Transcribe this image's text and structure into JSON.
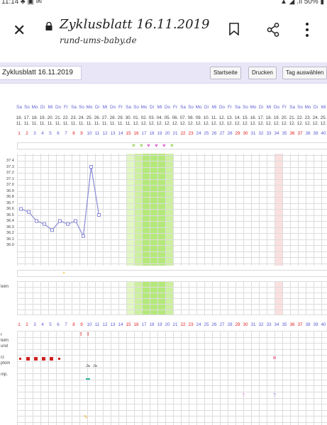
{
  "status_bar": {
    "left": "11:14 ♣ ▣ ✉",
    "right": "▲ ◢ .ıl 50% ▮"
  },
  "browser": {
    "title": "Zyklusblatt 16.11.2019",
    "url": "rund-ums-baby.de",
    "icons": [
      "close-icon",
      "lock-icon",
      "bookmark-icon",
      "share-icon",
      "more-vert-icon"
    ]
  },
  "toolbar": {
    "input_value": "Zyklusblatt 16.11.2019",
    "buttons": [
      "Startseite",
      "Drucken",
      "Tag auswählen"
    ]
  },
  "days": {
    "weekdays": [
      "Sa",
      "So",
      "Mo",
      "Di",
      "Mi",
      "Do",
      "Fr",
      "Sa",
      "So",
      "Mo",
      "Di",
      "Mi",
      "Do",
      "Fr",
      "Sa",
      "So",
      "Mo",
      "Di",
      "Mi",
      "Do",
      "Fr",
      "Sa",
      "So",
      "Mo",
      "Di",
      "Mi",
      "Do",
      "Fr",
      "Sa",
      "So",
      "Mo",
      "Di",
      "Mi",
      "Do",
      "Fr",
      "Sa",
      "So",
      "Mo",
      "Di",
      "Mi"
    ],
    "dates": [
      "16.",
      "17.",
      "18.",
      "19.",
      "20.",
      "21.",
      "22.",
      "23.",
      "24.",
      "25.",
      "26.",
      "27.",
      "28.",
      "29.",
      "30.",
      "01.",
      "02.",
      "03.",
      "04.",
      "05.",
      "06.",
      "07.",
      "08.",
      "09.",
      "10.",
      "11.",
      "12.",
      "13.",
      "14.",
      "15.",
      "16.",
      "17.",
      "18.",
      "19.",
      "20.",
      "21.",
      "22.",
      "23.",
      "24.",
      "25."
    ],
    "months": [
      "11.",
      "11.",
      "11.",
      "11.",
      "11.",
      "11.",
      "11.",
      "11.",
      "11.",
      "11.",
      "11.",
      "11.",
      "11.",
      "11.",
      "11.",
      "12.",
      "12.",
      "12.",
      "12.",
      "12.",
      "12.",
      "12.",
      "12.",
      "12.",
      "12.",
      "12.",
      "12.",
      "12.",
      "12.",
      "12.",
      "12.",
      "12.",
      "12.",
      "12.",
      "12.",
      "12.",
      "12.",
      "12.",
      "12.",
      "12."
    ],
    "cycle_days": [
      "1",
      "2",
      "3",
      "4",
      "5",
      "6",
      "7",
      "8",
      "9",
      "10",
      "11",
      "12",
      "13",
      "14",
      "15",
      "16",
      "17",
      "18",
      "19",
      "20",
      "21",
      "22",
      "23",
      "24",
      "25",
      "26",
      "27",
      "28",
      "29",
      "30",
      "31",
      "32",
      "33",
      "34",
      "35",
      "36",
      "37",
      "38",
      "39",
      "40"
    ]
  },
  "chart_data": {
    "type": "line",
    "xlabel": "",
    "ylabel": "",
    "y_ticks": [
      "37.4",
      "37.3",
      "37.2",
      "37.1",
      "37.0",
      "36.9",
      "36.8",
      "36.7",
      "36.6",
      "36.5",
      "36.4",
      "36.3",
      "36.2",
      "36.1",
      "36.0"
    ],
    "ylim": [
      36.0,
      37.4
    ],
    "x": [
      1,
      2,
      3,
      4,
      5,
      6,
      7,
      8,
      9,
      10,
      11
    ],
    "values": [
      36.6,
      36.55,
      36.4,
      36.35,
      36.25,
      36.4,
      36.35,
      36.4,
      36.15,
      37.3,
      36.5
    ],
    "series_color": "#8a8ad8",
    "fertile_window_cycle_days": [
      15,
      16,
      17,
      18,
      19,
      20
    ],
    "peak_cycle_days": [
      17,
      18,
      19
    ],
    "highlight_cycle_day": 33
  },
  "labels": {
    "schleim": "leim",
    "block_lines": [
      "r",
      "leim",
      "und",
      "",
      "rz",
      "ptom",
      "",
      "mp."
    ],
    "notes": [
      "Ja",
      "Ja"
    ]
  },
  "colors": {
    "accent_purple": "#5b5bd6",
    "weekend_red": "#e02020",
    "fertile_light": "#e3f7c5",
    "fertile_mid": "#cdf0a0",
    "fertile_peak": "#b4e97a",
    "highlight_pink": "#fbe0e0",
    "heart_pink": "#e070d0",
    "heart_green": "#a6d96a"
  }
}
